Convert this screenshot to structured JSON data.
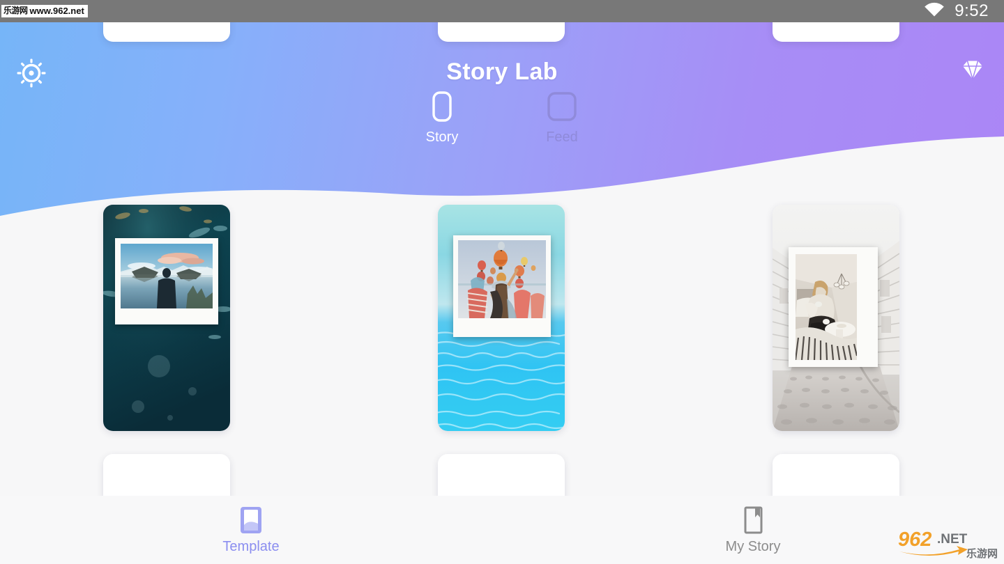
{
  "statusbar": {
    "watermark_cn": "乐游网",
    "watermark_url": "www.962.net",
    "wifi_icon": "wifi-icon",
    "time": "9:52"
  },
  "header": {
    "title": "Story Lab",
    "settings_icon": "gear-icon",
    "premium_icon": "diamond-icon",
    "gradient_from": "#76b5f8",
    "gradient_to": "#ab86f6"
  },
  "format_tabs": [
    {
      "label": "Story",
      "icon": "story-format-icon",
      "active": true
    },
    {
      "label": "Feed",
      "icon": "feed-format-icon",
      "active": false
    }
  ],
  "templates": [
    {
      "name": "mountain-lake-polaroid",
      "description": "Person in dark jacket before a mountain lake, polaroid frame on deep teal water backdrop"
    },
    {
      "name": "hot-air-balloons-polaroid",
      "description": "Woman pointing at hot air balloons, polaroid frame on bright turquoise water backdrop"
    },
    {
      "name": "cobblestone-street-frame",
      "description": "Woman reading in bed, white frame on pale cobblestone street backdrop"
    }
  ],
  "bottom_nav": [
    {
      "label": "Template",
      "icon": "template-icon",
      "active": true
    },
    {
      "label": "My Story",
      "icon": "bookmark-icon",
      "active": false
    }
  ],
  "corner_watermark": {
    "digits": "962",
    "tld": ".NET",
    "cn": "乐游网"
  },
  "colors": {
    "accent": "#8b8ef0",
    "inactive": "#8c8c8c",
    "tab_inactive": "#8f8ada",
    "page_bg": "#f7f7f8",
    "statusbar_bg": "#787878"
  }
}
